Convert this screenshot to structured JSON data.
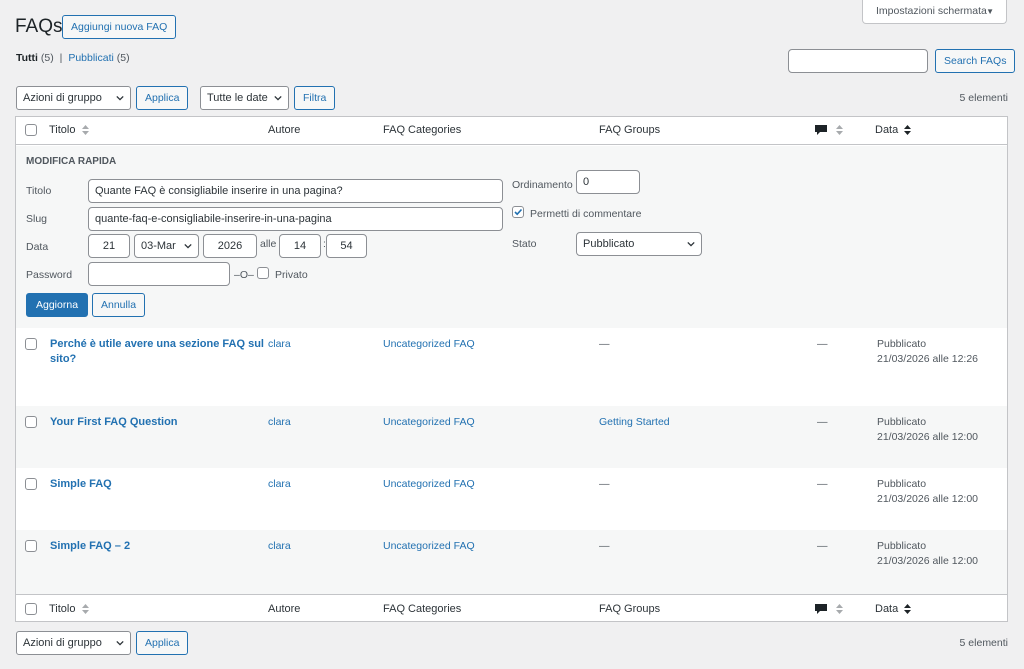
{
  "header": {
    "title": "FAQs",
    "add_new_label": "Aggiungi nuova FAQ",
    "screen_options_label": "Impostazioni schermata"
  },
  "filters": {
    "all_label": "Tutti",
    "all_count": "(5)",
    "separator": "|",
    "published_label": "Pubblicati",
    "published_count": "(5)"
  },
  "search": {
    "value": "",
    "button_label": "Search FAQs"
  },
  "top_nav": {
    "bulk_actions": "Azioni di gruppo",
    "apply_label": "Applica",
    "dates_select": "Tutte le date",
    "filter_label": "Filtra",
    "items_count": "5 elementi"
  },
  "bottom_nav": {
    "bulk_actions": "Azioni di gruppo",
    "apply_label": "Applica",
    "items_count": "5 elementi"
  },
  "columns": {
    "title": "Titolo",
    "author": "Autore",
    "categories": "FAQ Categories",
    "groups": "FAQ Groups",
    "date": "Data"
  },
  "quick_edit": {
    "heading": "MODIFICA RAPIDA",
    "title_label": "Titolo",
    "title_value": "Quante FAQ è consigliabile inserire in una pagina?",
    "slug_label": "Slug",
    "slug_value": "quante-faq-e-consigliabile-inserire-in-una-pagina",
    "date_label": "Data",
    "day": "21",
    "month": "03-Mar",
    "year": "2026",
    "at_label": "alle",
    "hour": "14",
    "time_sep": ":",
    "minute": "54",
    "password_label": "Password",
    "password_value": "",
    "or_label": "–O–",
    "private_label": "Privato",
    "order_label": "Ordinamento",
    "order_value": "0",
    "allow_comments_label": "Permetti di commentare",
    "allow_comments_checked": true,
    "status_label": "Stato",
    "status_value": "Pubblicato",
    "update_label": "Aggiorna",
    "cancel_label": "Annulla"
  },
  "rows": [
    {
      "title_line1": "Perché è utile avere una sezione FAQ sul",
      "title_line2": "sito?",
      "author": "clara",
      "category": "Uncategorized FAQ",
      "group": "—",
      "comments": "—",
      "status": "Pubblicato",
      "date": "21/03/2026 alle 12:26"
    },
    {
      "title_line1": "Your First FAQ Question",
      "title_line2": "",
      "author": "clara",
      "category": "Uncategorized FAQ",
      "group": "Getting Started",
      "comments": "—",
      "status": "Pubblicato",
      "date": "21/03/2026 alle 12:00"
    },
    {
      "title_line1": "Simple FAQ",
      "title_line2": "",
      "author": "clara",
      "category": "Uncategorized FAQ",
      "group": "—",
      "comments": "—",
      "status": "Pubblicato",
      "date": "21/03/2026 alle 12:00"
    },
    {
      "title_line1": "Simple FAQ – 2",
      "title_line2": "",
      "author": "clara",
      "category": "Uncategorized FAQ",
      "group": "—",
      "comments": "—",
      "status": "Pubblicato",
      "date": "21/03/2026 alle 12:00"
    }
  ],
  "colors": {
    "accent": "#2271b1",
    "background": "#f0f0f1",
    "border": "#c3c4c7"
  }
}
